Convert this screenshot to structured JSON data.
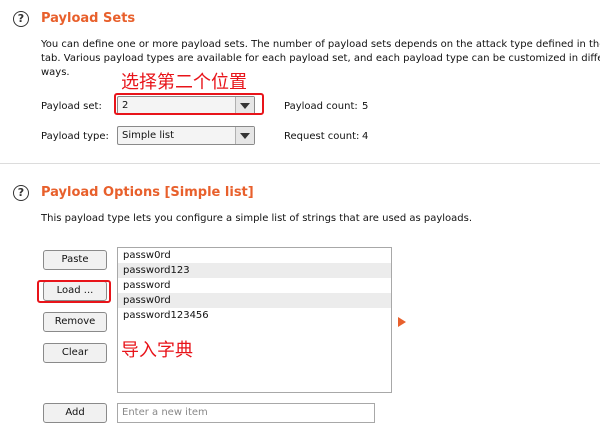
{
  "payload_sets": {
    "title": "Payload Sets",
    "description": [
      "You can define one or more payload sets. The number of payload sets depends on the attack type defined in the P",
      "tab. Various payload types are available for each payload set, and each payload type can be customized in differe",
      "ways."
    ],
    "set_label": "Payload set:",
    "set_value": "2",
    "type_label": "Payload type:",
    "type_value": "Simple list",
    "count_label": "Payload count:",
    "count_value": "5",
    "request_label": "Request count:",
    "request_value": "4"
  },
  "payload_options": {
    "title": "Payload Options [Simple list]",
    "description": "This payload type lets you configure a simple list of strings that are used as payloads.",
    "buttons": {
      "paste": "Paste",
      "load": "Load ...",
      "remove": "Remove",
      "clear": "Clear",
      "add": "Add"
    },
    "items": [
      "passw0rd",
      "password123",
      "password",
      "passw0rd",
      "password123456"
    ],
    "input_placeholder": "Enter a new item"
  },
  "annotations": {
    "select_second": "选择第二个位置",
    "import_dict": "导入字典"
  },
  "colors": {
    "accent": "#e8602c",
    "annotation": "#e8141a"
  }
}
